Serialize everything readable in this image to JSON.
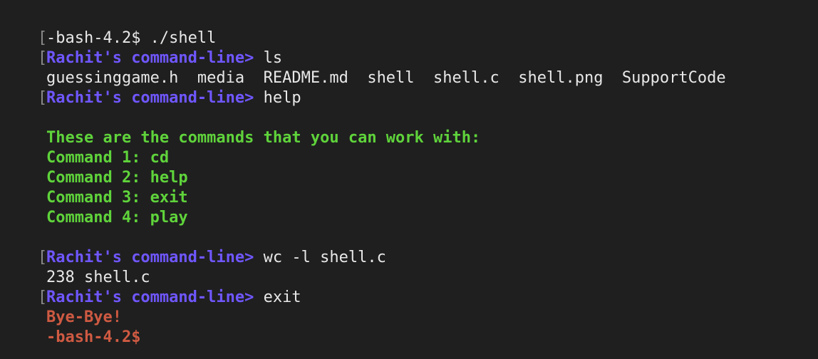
{
  "terminal": {
    "bracket_glyph": "[",
    "lines": {
      "l1": "-bash-4.2$ ./shell",
      "prompt": "Rachit's command-line>",
      "cmd_ls": " ls",
      "ls_output": "guessinggame.h  media  README.md  shell  shell.c  shell.png  SupportCode",
      "cmd_help": " help",
      "help_header": "These are the commands that you can work with:",
      "help_1": "Command 1: cd",
      "help_2": "Command 2: help",
      "help_3": "Command 3: exit",
      "help_4": "Command 4: play",
      "cmd_wc": " wc -l shell.c",
      "wc_output": "238 shell.c",
      "cmd_exit": " exit",
      "bye": "Bye-Bye!",
      "final_prompt": "-bash-4.2$"
    }
  },
  "colors": {
    "background": "#1f1f1f",
    "prompt": "#6f57ff",
    "help_text": "#5fd33b",
    "exit_text": "#cf5a42",
    "output_text": "#e8e8e8"
  }
}
